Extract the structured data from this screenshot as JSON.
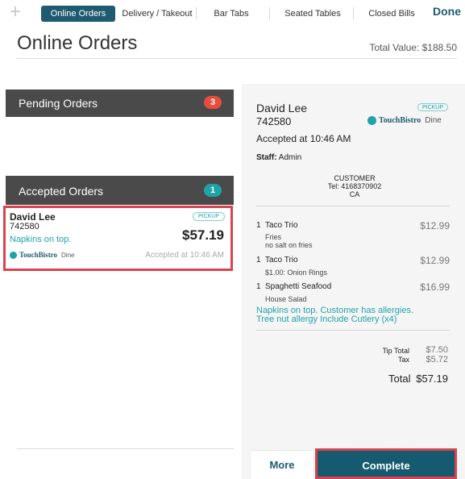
{
  "toolbar": {
    "add_symbol": "+",
    "tabs": [
      {
        "label": "Online Orders",
        "active": true
      },
      {
        "label": "Delivery / Takeout",
        "active": false
      },
      {
        "label": "Bar Tabs",
        "active": false
      },
      {
        "label": "Seated Tables",
        "active": false
      },
      {
        "label": "Closed Bills",
        "active": false
      }
    ],
    "done_label": "Done"
  },
  "header": {
    "title": "Online Orders",
    "total_value": "Total Value: $188.50"
  },
  "pending": {
    "label": "Pending Orders",
    "count": "3"
  },
  "accepted": {
    "label": "Accepted Orders",
    "count": "1",
    "orders": [
      {
        "name": "David Lee",
        "number": "742580",
        "note": "Napkins on top.",
        "type": "PICKUP",
        "amount": "$57.19",
        "brand": "TouchBistro",
        "channel": "Dine",
        "accepted_at": "Accepted at 10:46 AM"
      }
    ]
  },
  "detail": {
    "name": "David Lee",
    "number": "742580",
    "type": "PICKUP",
    "brand": "TouchBistro",
    "channel": "Dine",
    "accepted_at": "Accepted at 10:46 AM",
    "staff_label": "Staff:",
    "staff_name": "Admin",
    "customer": {
      "heading": "CUSTOMER",
      "tel": "Tel: 4168370902",
      "region": "CA"
    },
    "items": [
      {
        "qty": "1",
        "name": "Taco Trio",
        "price": "$12.99",
        "mods": [
          "Fries",
          "no salt on fries"
        ]
      },
      {
        "qty": "1",
        "name": "Taco Trio",
        "price": "$12.99",
        "mods": [
          "$1.00: Onion Rings"
        ]
      },
      {
        "qty": "1",
        "name": "Spaghetti Seafood",
        "price": "$16.99",
        "mods": [
          "House Salad"
        ]
      }
    ],
    "notes_line1": "Napkins on top. Customer has allergies.",
    "notes_line2": "Tree nut allergy Include Cutlery (x4)",
    "tip_label": "Tip Total",
    "tip_value": "$7.50",
    "tax_label": "Tax",
    "tax_value": "$5.72",
    "total_label": "Total",
    "total_value": "$57.19"
  },
  "actions": {
    "more_label": "More",
    "complete_label": "Complete"
  },
  "colors": {
    "primary": "#1e5b70",
    "accent": "#1fa3a8",
    "badge_red": "#e74c3c",
    "highlight": "#d9434f"
  }
}
